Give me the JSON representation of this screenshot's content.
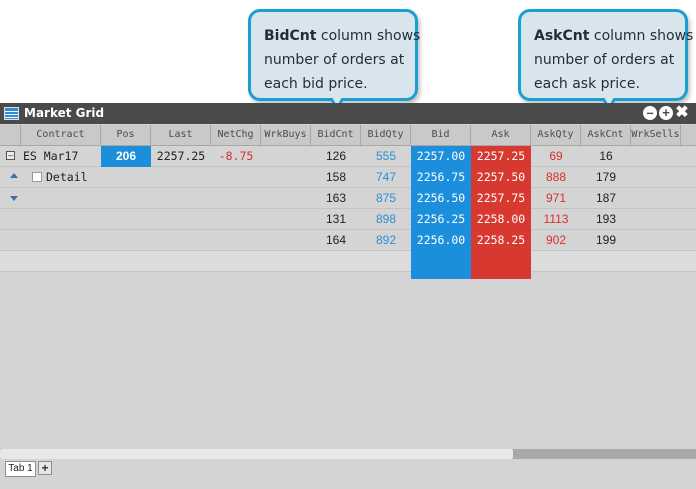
{
  "callouts": {
    "bidcnt": {
      "term": "BidCnt",
      "line1_rest": " column shows",
      "line2": "number of orders at",
      "line3": "each bid price."
    },
    "askcnt": {
      "term": "AskCnt",
      "line1_rest": " column shows",
      "line2": "number of orders at",
      "line3": "each ask price."
    }
  },
  "window": {
    "title": "Market Grid",
    "icon": "grid-icon",
    "controls": {
      "minimize": "minus-circle-icon",
      "add": "plus-circle-icon",
      "close": "close-icon"
    }
  },
  "columns": [
    "Contract",
    "Pos",
    "Last",
    "NetChg",
    "WrkBuys",
    "BidCnt",
    "BidQty",
    "Bid",
    "Ask",
    "AskQty",
    "AskCnt",
    "WrkSells"
  ],
  "instrument": {
    "contract": "ES Mar17",
    "pos": "206",
    "last": "2257.25",
    "netchg": "-8.75",
    "detail_label": "Detail"
  },
  "rows": [
    {
      "bidcnt": "126",
      "bidqty": "555",
      "bid": "2257.00",
      "ask": "2257.25",
      "askqty": "69",
      "askcnt": "16"
    },
    {
      "bidcnt": "158",
      "bidqty": "747",
      "bid": "2256.75",
      "ask": "2257.50",
      "askqty": "888",
      "askcnt": "179"
    },
    {
      "bidcnt": "163",
      "bidqty": "875",
      "bid": "2256.50",
      "ask": "2257.75",
      "askqty": "971",
      "askcnt": "187"
    },
    {
      "bidcnt": "131",
      "bidqty": "898",
      "bid": "2256.25",
      "ask": "2258.00",
      "askqty": "1113",
      "askcnt": "193"
    },
    {
      "bidcnt": "164",
      "bidqty": "892",
      "bid": "2256.00",
      "ask": "2258.25",
      "askqty": "902",
      "askcnt": "199"
    }
  ],
  "tabs": [
    {
      "label": "Tab 1"
    }
  ],
  "add_tab": "+",
  "colors": {
    "bid": "#1b8fdc",
    "ask": "#d73830",
    "callout_border": "#1b9fd1",
    "titlebar": "#4a4a4a"
  }
}
